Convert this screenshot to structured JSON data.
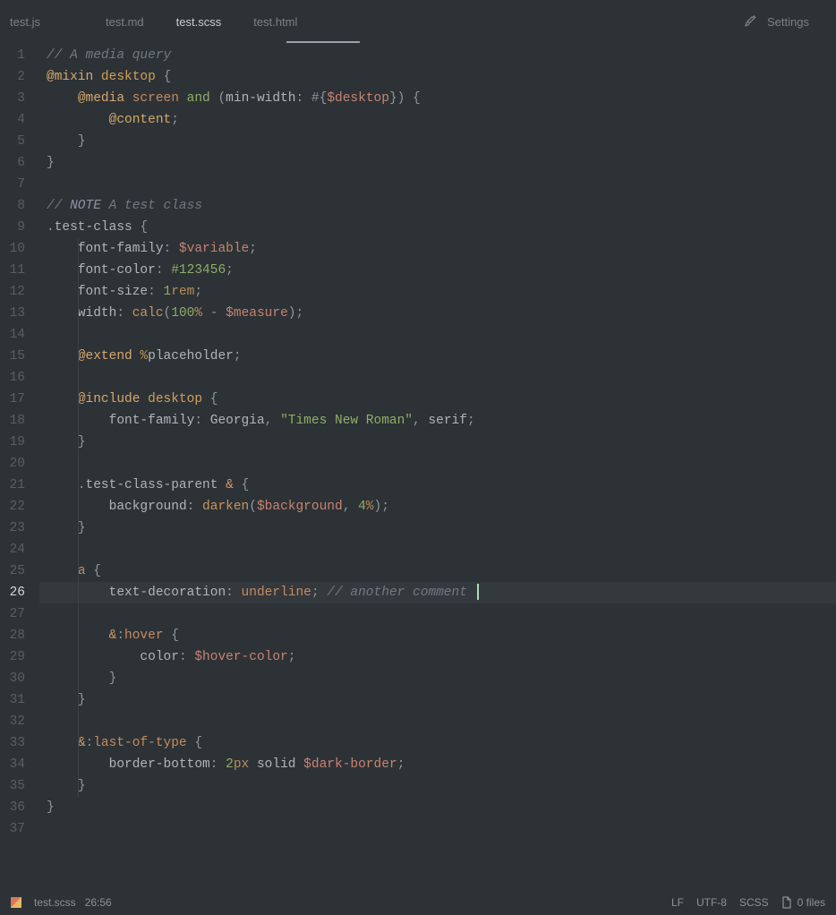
{
  "tabs": [
    "test.js",
    "test.md",
    "test.scss",
    "test.html"
  ],
  "active_tab_index": 2,
  "settings_label": "Settings",
  "gutter": {
    "lines": 37,
    "current": 26
  },
  "status": {
    "filename": "test.scss",
    "position": "26:56",
    "eol": "LF",
    "encoding": "UTF-8",
    "language": "SCSS",
    "files": "0 files"
  },
  "code": [
    [
      [
        "c-comment",
        "// A media query"
      ]
    ],
    [
      [
        "c-atrule",
        "@mixin"
      ],
      [
        "",
        ""
      ],
      [
        "c-mixname",
        " desktop "
      ],
      [
        "c-brace",
        "{"
      ]
    ],
    [
      [
        "",
        "    "
      ],
      [
        "c-atrule",
        "@media"
      ],
      [
        "",
        ""
      ],
      [
        "c-kw",
        " screen "
      ],
      [
        "c-and",
        "and"
      ],
      [
        "",
        ""
      ],
      [
        "c-punc",
        " ("
      ],
      [
        "c-prop",
        "min-width"
      ],
      [
        "c-colon",
        ":"
      ],
      [
        "",
        ""
      ],
      [
        "c-punc",
        " #"
      ],
      [
        "c-brace",
        "{"
      ],
      [
        "c-var",
        "$desktop"
      ],
      [
        "c-brace",
        "}"
      ],
      [
        "c-punc",
        ")"
      ],
      [
        "",
        ""
      ],
      [
        "c-brace",
        " {"
      ]
    ],
    [
      [
        "",
        "        "
      ],
      [
        "c-content",
        "@content"
      ],
      [
        "c-punc",
        ";"
      ]
    ],
    [
      [
        "",
        "    "
      ],
      [
        "c-brace",
        "}"
      ]
    ],
    [
      [
        "c-brace",
        "}"
      ]
    ],
    [],
    [
      [
        "c-comment",
        "// "
      ],
      [
        "c-note",
        "NOTE"
      ],
      [
        "c-comment",
        " A test class"
      ]
    ],
    [
      [
        "c-punc",
        "."
      ],
      [
        "c-class",
        "test-class "
      ],
      [
        "c-brace",
        "{"
      ]
    ],
    [
      [
        "",
        "    "
      ],
      [
        "c-prop",
        "font-family"
      ],
      [
        "c-colon",
        ":"
      ],
      [
        "",
        ""
      ],
      [
        "c-var",
        " $variable"
      ],
      [
        "c-punc",
        ";"
      ]
    ],
    [
      [
        "",
        "    "
      ],
      [
        "c-prop",
        "font-color"
      ],
      [
        "c-colon",
        ":"
      ],
      [
        "",
        ""
      ],
      [
        "c-hex",
        " #123456"
      ],
      [
        "c-punc",
        ";"
      ]
    ],
    [
      [
        "",
        "    "
      ],
      [
        "c-prop",
        "font-size"
      ],
      [
        "c-colon",
        ":"
      ],
      [
        "",
        ""
      ],
      [
        "c-num",
        " 1"
      ],
      [
        "c-unit",
        "rem"
      ],
      [
        "c-punc",
        ";"
      ]
    ],
    [
      [
        "",
        "    "
      ],
      [
        "c-prop",
        "width"
      ],
      [
        "c-colon",
        ":"
      ],
      [
        "",
        ""
      ],
      [
        "c-func",
        " calc"
      ],
      [
        "c-punc",
        "("
      ],
      [
        "c-num",
        "100"
      ],
      [
        "c-unit",
        "%"
      ],
      [
        "c-op",
        " - "
      ],
      [
        "c-var",
        "$measure"
      ],
      [
        "c-punc",
        ")"
      ],
      [
        "c-punc",
        ";"
      ]
    ],
    [],
    [
      [
        "",
        "    "
      ],
      [
        "c-atrule",
        "@extend"
      ],
      [
        "",
        ""
      ],
      [
        "c-pct",
        " %"
      ],
      [
        "c-placeholder",
        "placeholder"
      ],
      [
        "c-punc",
        ";"
      ]
    ],
    [],
    [
      [
        "",
        "    "
      ],
      [
        "c-atrule",
        "@include"
      ],
      [
        "",
        ""
      ],
      [
        "c-mixname",
        " desktop "
      ],
      [
        "c-brace",
        "{"
      ]
    ],
    [
      [
        "",
        "        "
      ],
      [
        "c-prop",
        "font-family"
      ],
      [
        "c-colon",
        ":"
      ],
      [
        "",
        ""
      ],
      [
        "c-ident",
        " Georgia"
      ],
      [
        "c-punc",
        ","
      ],
      [
        "",
        ""
      ],
      [
        "c-str",
        " \"Times New Roman\""
      ],
      [
        "c-punc",
        ","
      ],
      [
        "",
        ""
      ],
      [
        "c-ident",
        " serif"
      ],
      [
        "c-punc",
        ";"
      ]
    ],
    [
      [
        "",
        "    "
      ],
      [
        "c-brace",
        "}"
      ]
    ],
    [],
    [
      [
        "",
        "    "
      ],
      [
        "c-punc",
        "."
      ],
      [
        "c-class",
        "test-class-parent "
      ],
      [
        "c-amp",
        "& "
      ],
      [
        "c-brace",
        "{"
      ]
    ],
    [
      [
        "",
        "        "
      ],
      [
        "c-prop",
        "background"
      ],
      [
        "c-colon",
        ":"
      ],
      [
        "",
        ""
      ],
      [
        "c-func",
        " darken"
      ],
      [
        "c-punc",
        "("
      ],
      [
        "c-var",
        "$background"
      ],
      [
        "c-punc",
        ","
      ],
      [
        "",
        ""
      ],
      [
        "c-num",
        " 4"
      ],
      [
        "c-unit",
        "%"
      ],
      [
        "c-punc",
        ")"
      ],
      [
        "c-punc",
        ";"
      ]
    ],
    [
      [
        "",
        "    "
      ],
      [
        "c-brace",
        "}"
      ]
    ],
    [],
    [
      [
        "",
        "    "
      ],
      [
        "c-tag",
        "a "
      ],
      [
        "c-brace",
        "{"
      ]
    ],
    [
      [
        "",
        "        "
      ],
      [
        "c-prop",
        "text-decoration"
      ],
      [
        "c-colon",
        ":"
      ],
      [
        "",
        ""
      ],
      [
        "c-value",
        " underline"
      ],
      [
        "c-punc",
        ";"
      ],
      [
        "",
        ""
      ],
      [
        "c-comment",
        " // another comment "
      ]
    ],
    [],
    [
      [
        "",
        "        "
      ],
      [
        "c-amp",
        "&"
      ],
      [
        "c-colon",
        ":"
      ],
      [
        "c-pseudo",
        "hover "
      ],
      [
        "c-brace",
        "{"
      ]
    ],
    [
      [
        "",
        "            "
      ],
      [
        "c-prop",
        "color"
      ],
      [
        "c-colon",
        ":"
      ],
      [
        "",
        ""
      ],
      [
        "c-var",
        " $hover-color"
      ],
      [
        "c-punc",
        ";"
      ]
    ],
    [
      [
        "",
        "        "
      ],
      [
        "c-brace",
        "}"
      ]
    ],
    [
      [
        "",
        "    "
      ],
      [
        "c-brace",
        "}"
      ]
    ],
    [],
    [
      [
        "",
        "    "
      ],
      [
        "c-amp",
        "&"
      ],
      [
        "c-colon",
        ":"
      ],
      [
        "c-pseudo",
        "last-of-type "
      ],
      [
        "c-brace",
        "{"
      ]
    ],
    [
      [
        "",
        "        "
      ],
      [
        "c-prop",
        "border-bottom"
      ],
      [
        "c-colon",
        ":"
      ],
      [
        "",
        ""
      ],
      [
        "c-num",
        " 2"
      ],
      [
        "c-unit",
        "px"
      ],
      [
        "",
        ""
      ],
      [
        "c-ident",
        " solid"
      ],
      [
        "",
        ""
      ],
      [
        "c-var",
        " $dark-border"
      ],
      [
        "c-punc",
        ";"
      ]
    ],
    [
      [
        "",
        "    "
      ],
      [
        "c-brace",
        "}"
      ]
    ],
    [
      [
        "c-brace",
        "}"
      ]
    ],
    []
  ]
}
